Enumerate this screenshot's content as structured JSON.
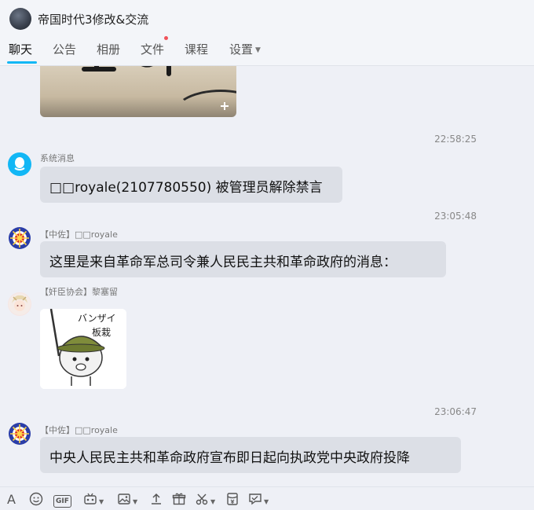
{
  "window": {
    "title": "帝国时代3修改&交流"
  },
  "tabs": [
    {
      "label": "聊天"
    },
    {
      "label": "公告"
    },
    {
      "label": "相册"
    },
    {
      "label": "文件"
    },
    {
      "label": "课程"
    },
    {
      "label": "设置"
    }
  ],
  "messages": {
    "time1": "22:58:25",
    "system_sender": "系统消息",
    "system_text": "□□royale(2107780550) 被管理员解除禁言",
    "time2": "23:05:48",
    "msg1_sender": "【中佐】□□royale",
    "msg1_text": "这里是来自革命军总司令兼人民民主共和革命政府的消息：",
    "msg2_sender": "【奸臣协会】黎塞留",
    "sticker_text_line1": "バンザイ",
    "sticker_text_line2": "板栽",
    "time3": "23:06:47",
    "msg3_sender": "【中佐】□□royale",
    "msg3_text": "中央人民民主共和革命政府宣布即日起向执政党中央政府投降"
  },
  "toolbar": {
    "font": "A",
    "gif": "GIF"
  },
  "colors": {
    "accent": "#12b7f5",
    "notify_dot": "#f0525a",
    "bubble": "#dcdfe6",
    "background": "#eef0f6"
  }
}
